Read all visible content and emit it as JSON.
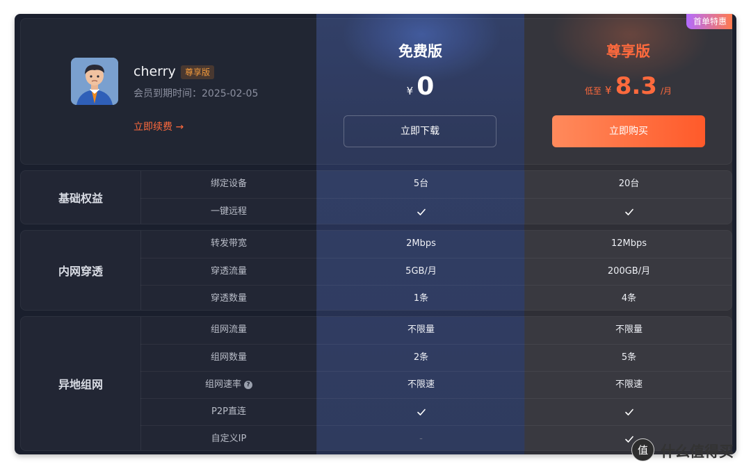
{
  "header": {
    "user": {
      "name": "cherry",
      "badge": "尊享版",
      "expiry_label": "会员到期时间：2025-02-05",
      "renew_label": "立即续费 →"
    },
    "free_plan": {
      "title": "免费版",
      "currency": "¥",
      "price": "0",
      "button": "立即下载"
    },
    "pro_plan": {
      "title": "尊享版",
      "price_prefix": "低至",
      "currency": "¥",
      "price": "8.3",
      "unit": "/月",
      "button": "立即购买",
      "promo_tag": "首单特惠"
    }
  },
  "sections": [
    {
      "category": "基础权益",
      "rows": [
        {
          "feature": "绑定设备",
          "free": "5台",
          "pro": "20台"
        },
        {
          "feature": "一键远程",
          "free": "check",
          "pro": "check"
        }
      ]
    },
    {
      "category": "内网穿透",
      "rows": [
        {
          "feature": "转发带宽",
          "free": "2Mbps",
          "pro": "12Mbps"
        },
        {
          "feature": "穿透流量",
          "free": "5GB/月",
          "pro": "200GB/月"
        },
        {
          "feature": "穿透数量",
          "free": "1条",
          "pro": "4条"
        }
      ]
    },
    {
      "category": "异地组网",
      "rows": [
        {
          "feature": "组网流量",
          "free": "不限量",
          "pro": "不限量"
        },
        {
          "feature": "组网数量",
          "free": "2条",
          "pro": "5条"
        },
        {
          "feature": "组网速率",
          "free": "不限速",
          "pro": "不限速",
          "help": "?"
        },
        {
          "feature": "P2P直连",
          "free": "check",
          "pro": "check"
        },
        {
          "feature": "自定义IP",
          "free": "-",
          "pro": "check"
        }
      ]
    }
  ],
  "watermark": {
    "text": "什么值得买",
    "logo": "值"
  },
  "colors": {
    "accent": "#ff6a3d",
    "panel": "#1a1f2d",
    "free_column": "#283356",
    "pro_column": "#2f2f36"
  }
}
